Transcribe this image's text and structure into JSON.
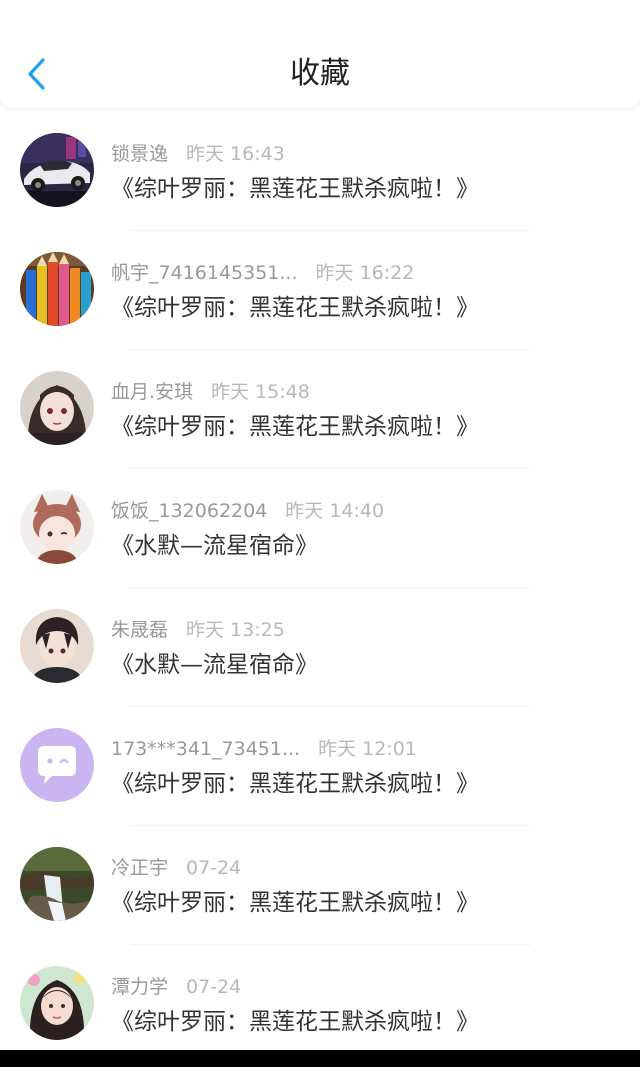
{
  "header": {
    "title": "收藏"
  },
  "colors": {
    "accent": "#1e9ef0",
    "username": "#999999",
    "time": "#b8b8b8",
    "title": "#333333"
  },
  "items": [
    {
      "username": "锁景逸",
      "time": "昨天 16:43",
      "book": "《综叶罗丽：黑莲花王默杀疯啦！》",
      "avatar_icon": "sports-car-avatar-icon"
    },
    {
      "username": "帆宇_7416145351...",
      "time": "昨天 16:22",
      "book": "《综叶罗丽：黑莲花王默杀疯啦！》",
      "avatar_icon": "colored-pencils-avatar-icon"
    },
    {
      "username": "血月.安琪",
      "time": "昨天 15:48",
      "book": "《综叶罗丽：黑莲花王默杀疯啦！》",
      "avatar_icon": "anime-girl-avatar-icon"
    },
    {
      "username": "饭饭_132062204",
      "time": "昨天 14:40",
      "book": "《水默—流星宿命》",
      "avatar_icon": "cat-ear-chibi-avatar-icon"
    },
    {
      "username": "朱晟磊",
      "time": "昨天 13:25",
      "book": "《水默—流星宿命》",
      "avatar_icon": "anime-boy-avatar-icon"
    },
    {
      "username": "173***341_73451...",
      "time": "昨天 12:01",
      "book": "《综叶罗丽：黑莲花王默杀疯啦！》",
      "avatar_icon": "chat-bubble-avatar-icon"
    },
    {
      "username": "冷正宇",
      "time": "07-24",
      "book": "《综叶罗丽：黑莲花王默杀疯啦！》",
      "avatar_icon": "waterfall-avatar-icon"
    },
    {
      "username": "潭力学",
      "time": "07-24",
      "book": "《综叶罗丽：黑莲花王默杀疯啦！》",
      "avatar_icon": "girl-photo-avatar-icon"
    }
  ]
}
